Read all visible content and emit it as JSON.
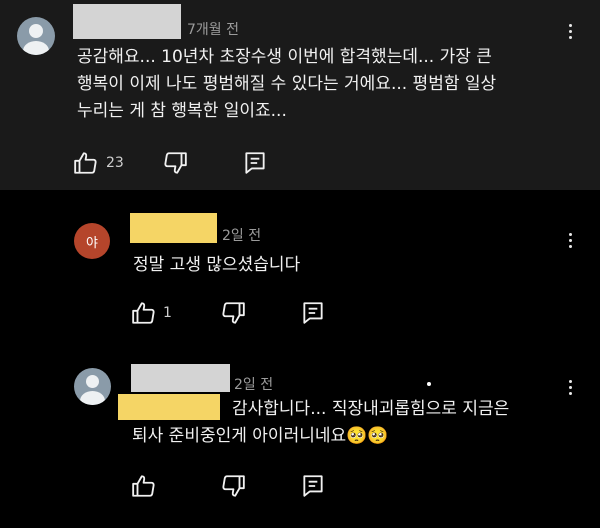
{
  "comments": [
    {
      "avatar_icon": "default-avatar-icon",
      "time": "7개월 전",
      "text": "공감해요... 10년차 초장수생 이번에 합격했는데... 가장 큰\n행복이 이제 나도 평범해질 수 있다는 거에요... 평범함 일상\n누리는 게 참 행복한 일이죠...",
      "likes": "23"
    },
    {
      "avatar_letter": "야",
      "time": "2일 전",
      "text": "정말 고생 많으셨습니다",
      "likes": "1"
    },
    {
      "avatar_icon": "default-avatar-icon",
      "time": "2일 전",
      "text": "감사합니다... 직장내괴롭힘으로 지금은\n퇴사 준비중인게 아이러니네요🥺🥺",
      "likes": ""
    }
  ],
  "colors": {
    "top_card_bg": "#1a1a1a",
    "page_bg": "#000000",
    "redact_yellow": "#f5d565",
    "redact_gray": "#d4d4d4"
  }
}
